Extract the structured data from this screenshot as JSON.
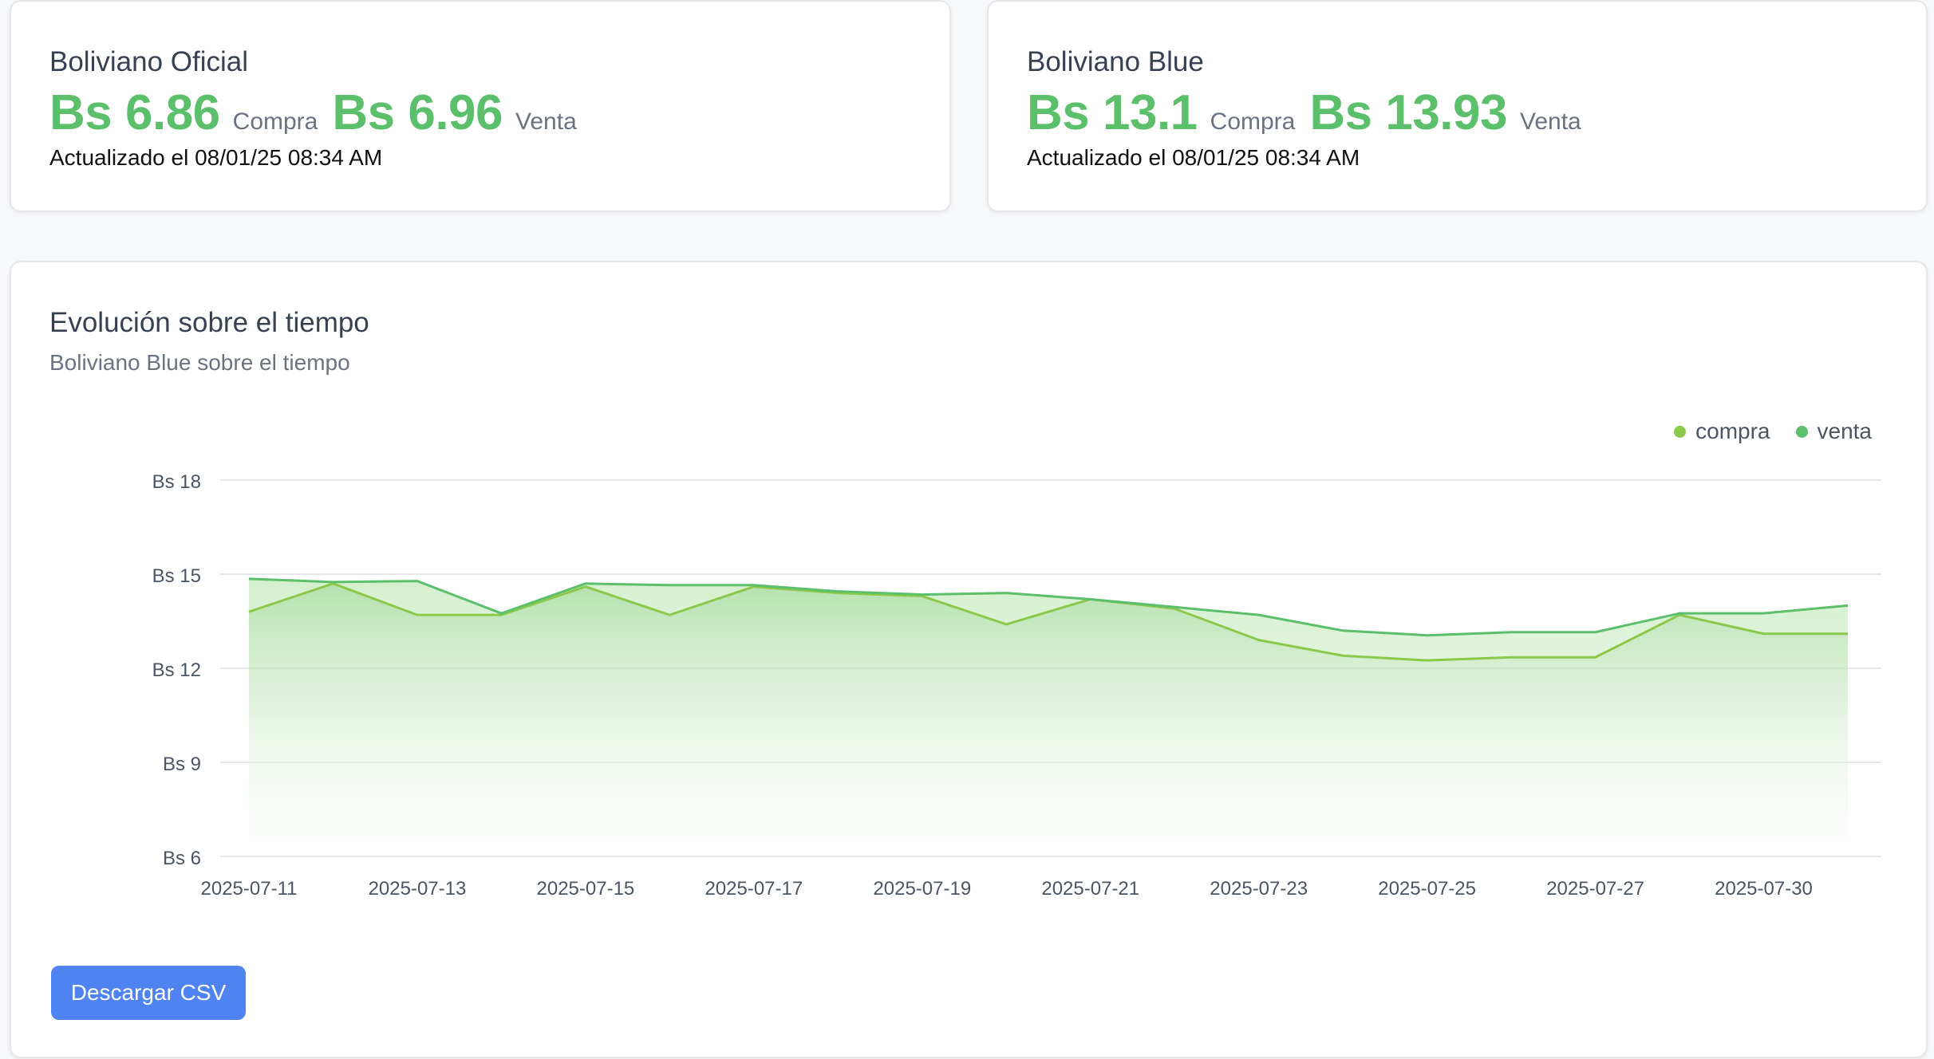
{
  "oficial": {
    "title": "Boliviano Oficial",
    "compra_value": "Bs 6.86",
    "compra_label": "Compra",
    "venta_value": "Bs 6.96",
    "venta_label": "Venta",
    "updated": "Actualizado el 08/01/25 08:34 AM"
  },
  "blue": {
    "title": "Boliviano Blue",
    "compra_value": "Bs 13.1",
    "compra_label": "Compra",
    "venta_value": "Bs 13.93",
    "venta_label": "Venta",
    "updated": "Actualizado el 08/01/25 08:34 AM"
  },
  "chart_section": {
    "title": "Evolución sobre el tiempo",
    "subtitle": "Boliviano Blue sobre el tiempo",
    "download_label": "Descargar CSV"
  },
  "colors": {
    "value_green": "#5cbf6b",
    "compra_line": "#8cc84b",
    "venta_line": "#5cbf6b",
    "button_blue": "#4f83f1"
  },
  "chart_data": {
    "type": "area",
    "title": "",
    "xlabel": "",
    "ylabel": "",
    "x_ticks": [
      "2025-07-11",
      "2025-07-13",
      "2025-07-15",
      "2025-07-17",
      "2025-07-19",
      "2025-07-21",
      "2025-07-23",
      "2025-07-25",
      "2025-07-27",
      "2025-07-30"
    ],
    "y_ticks": [
      "Bs 18",
      "Bs 15",
      "Bs 12",
      "Bs 9",
      "Bs 6"
    ],
    "ylim": [
      6,
      18
    ],
    "grid": true,
    "legend_position": "top-right",
    "series": [
      {
        "name": "compra",
        "color": "#8cc84b",
        "values": [
          13.8,
          14.7,
          13.7,
          13.7,
          14.6,
          13.7,
          14.6,
          14.4,
          14.3,
          13.4,
          14.2,
          13.9,
          12.9,
          12.4,
          12.25,
          12.35,
          12.35,
          13.7,
          13.1,
          13.1
        ]
      },
      {
        "name": "venta",
        "color": "#5cbf6b",
        "values": [
          14.85,
          14.75,
          14.78,
          13.75,
          14.7,
          14.65,
          14.65,
          14.45,
          14.35,
          14.4,
          14.2,
          13.95,
          13.7,
          13.2,
          13.05,
          13.15,
          13.15,
          13.75,
          13.75,
          14.0
        ]
      }
    ]
  }
}
